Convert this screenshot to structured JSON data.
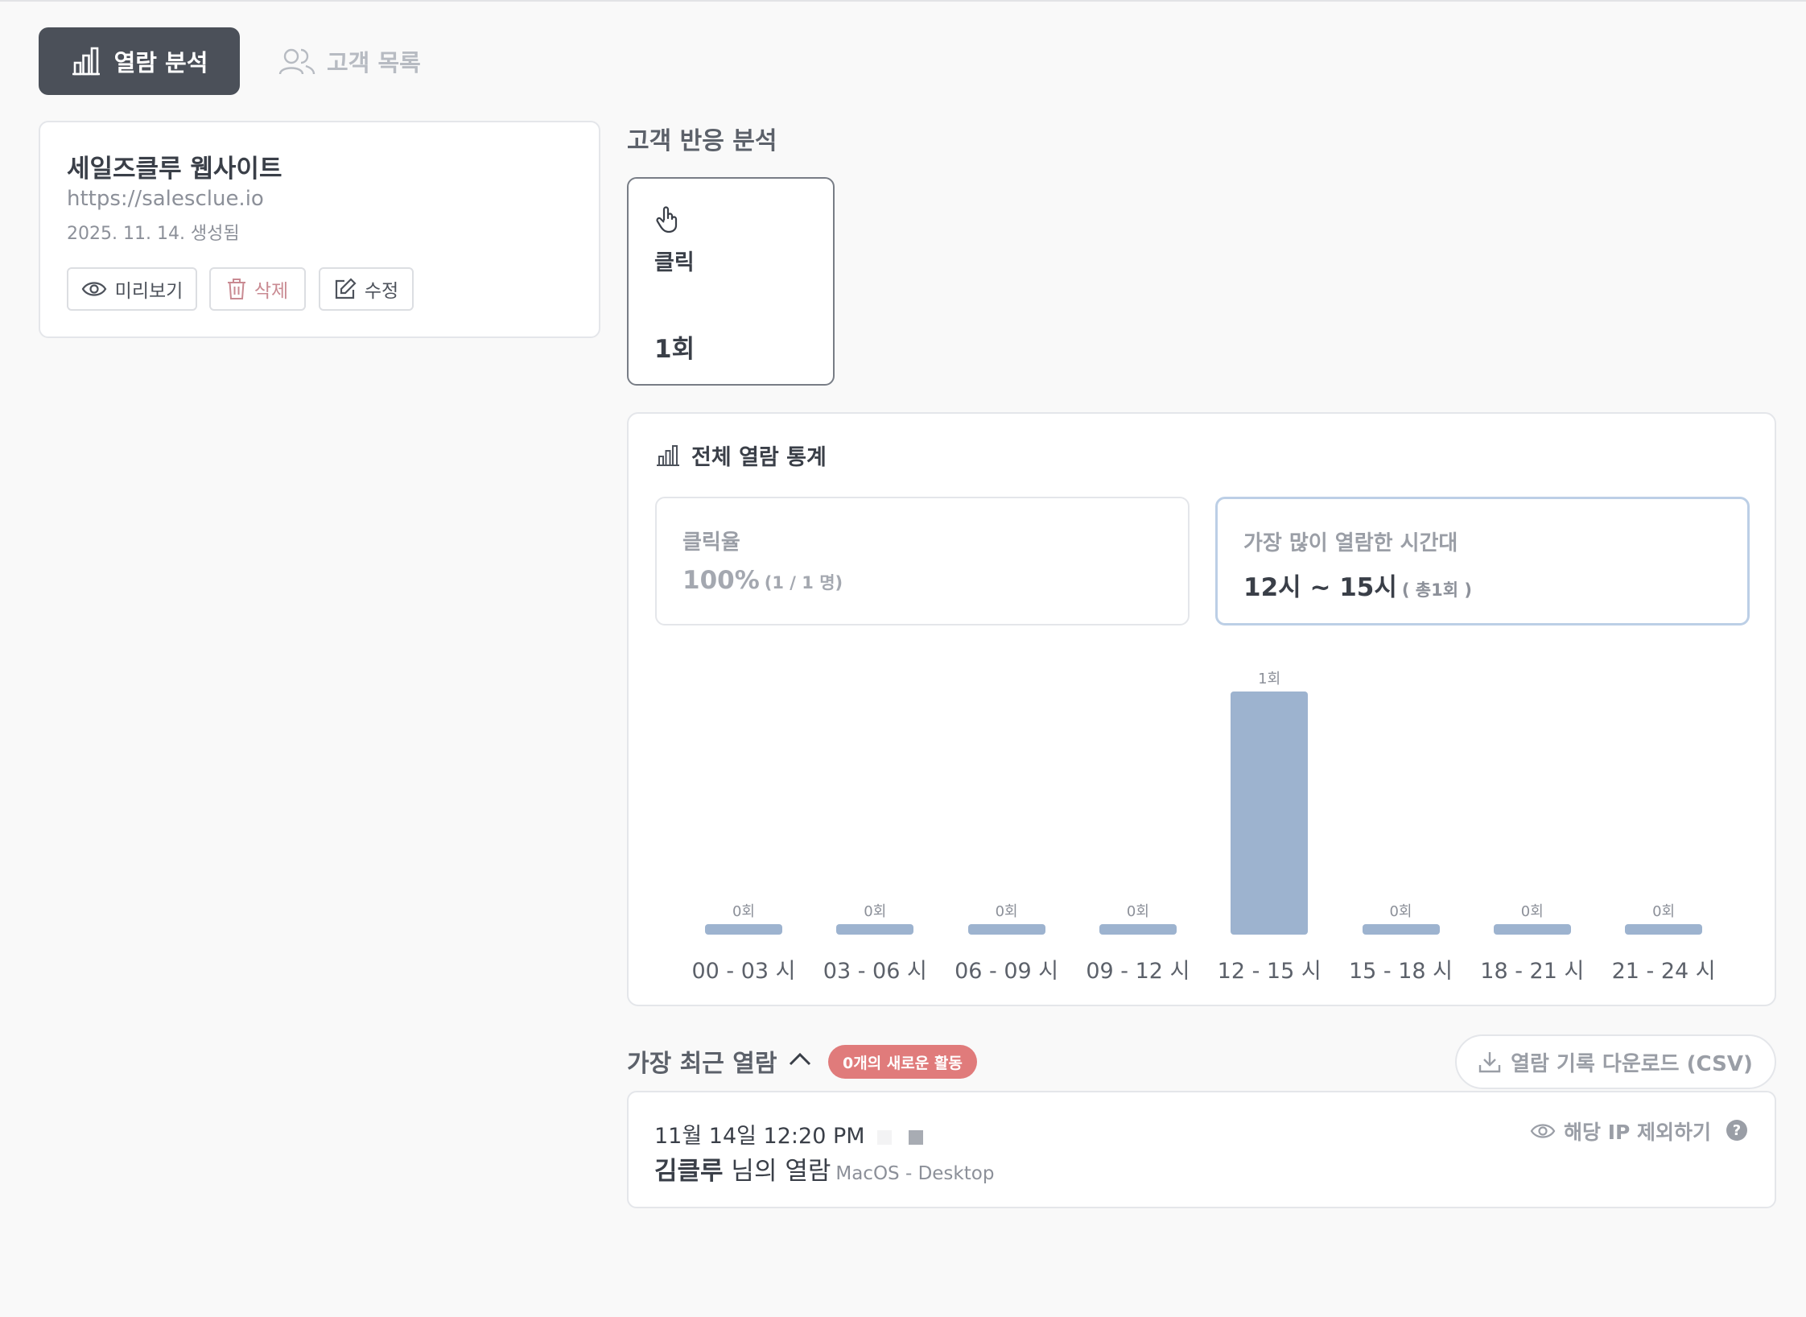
{
  "tabs": {
    "analytics_label": "열람 분석",
    "customers_label": "고객 목록"
  },
  "site": {
    "name": "세일즈클루 웹사이트",
    "url": "https://salesclue.io",
    "created": "2025. 11. 14. 생성됨",
    "preview_label": "미리보기",
    "delete_label": "삭제",
    "edit_label": "수정"
  },
  "reaction": {
    "title": "고객 반응 분석",
    "click_label": "클릭",
    "click_count": "1회"
  },
  "stats": {
    "title": "전체 열람 통계",
    "click_rate_label": "클릭율",
    "click_rate_value": "100%",
    "click_rate_sub": "(1 / 1 명)",
    "peak_label": "가장 많이 열람한 시간대",
    "peak_value": "12시 ~ 15시",
    "peak_sub": "( 총1회 )"
  },
  "chart_data": {
    "type": "bar",
    "categories": [
      "00 - 03 시",
      "03 - 06 시",
      "06 - 09 시",
      "09 - 12 시",
      "12 - 15 시",
      "15 - 18 시",
      "18 - 21 시",
      "21 - 24 시"
    ],
    "values": [
      0,
      0,
      0,
      0,
      1,
      0,
      0,
      0
    ],
    "data_labels": [
      "0회",
      "0회",
      "0회",
      "0회",
      "1회",
      "0회",
      "0회",
      "0회"
    ],
    "ylim": [
      0,
      1
    ],
    "color": "#9db3cf"
  },
  "recent": {
    "title": "가장 최근 열람",
    "badge": "0개의 새로운 활동",
    "csv_label": "열람 기록 다운로드 (CSV)"
  },
  "activity": {
    "time": "11월 14일 12:20 PM",
    "name": "김클루",
    "suffix": "님의 열람",
    "device": "MacOS - Desktop",
    "exclude_label": "해당 IP 제외하기",
    "help": "?"
  }
}
